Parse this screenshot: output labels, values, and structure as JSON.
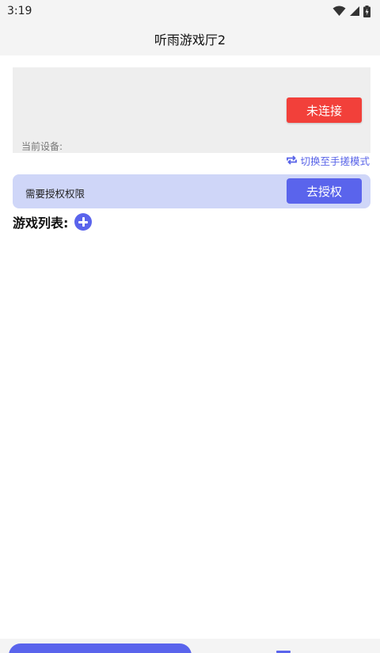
{
  "status_bar": {
    "time": "3:19",
    "icons": [
      "wifi-icon",
      "signal-icon",
      "battery-charging-icon"
    ]
  },
  "app_bar": {
    "title": "听雨游戏厅2"
  },
  "device_card": {
    "connect_button_label": "未连接",
    "current_device_label": "当前设备:"
  },
  "switch_mode": {
    "label": "切换至手搓模式",
    "icon": "repeat-icon"
  },
  "auth_banner": {
    "message": "需要授权权限",
    "button_label": "去授权"
  },
  "game_list": {
    "title": "游戏列表:",
    "add_icon": "plus-circle-icon"
  },
  "colors": {
    "accent": "#5a64ec",
    "danger": "#f2403a",
    "banner_bg": "#cfd6f8",
    "card_bg": "#eeeeee"
  }
}
